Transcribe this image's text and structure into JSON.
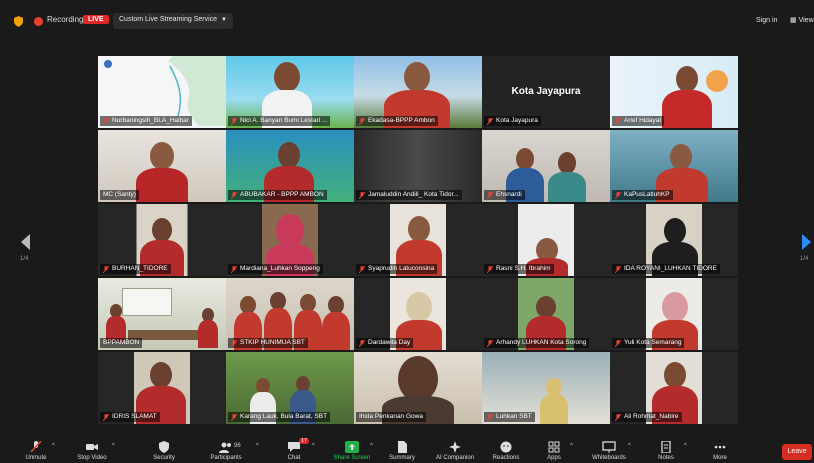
{
  "topbar": {
    "recording": "Recording",
    "live": "LIVE",
    "stream_menu": "Custom Live Streaming Service",
    "sign_in": "Sign in",
    "view": "View"
  },
  "pager": {
    "left": "1/4",
    "right": "1/4"
  },
  "participants": [
    {
      "name": "Nurbaningsih_BLA_Halbar",
      "muted": true
    },
    {
      "name": "Nici A. Banyan Bumi Lestari ...",
      "muted": true
    },
    {
      "name": "Ekadasa-BPPP Ambon",
      "muted": true
    },
    {
      "name": "Kota Jayapura",
      "muted": true,
      "center_label": "Kota Jayapura"
    },
    {
      "name": "Arief Hidayat",
      "muted": true
    },
    {
      "name": "MC (Santy)",
      "muted": false
    },
    {
      "name": "ABUBAKAR - BPPP AMBON",
      "muted": true
    },
    {
      "name": "Jamaluddin Andili_ Kota Tidor...",
      "muted": true
    },
    {
      "name": "Ehsnardi",
      "muted": true
    },
    {
      "name": "KaPusLatluhKP",
      "muted": true
    },
    {
      "name": "BURHAN_TIDORE",
      "muted": true
    },
    {
      "name": "Mardiana_Luhkan Soppeng",
      "muted": true
    },
    {
      "name": "Syaprudin Latuconsina",
      "muted": true
    },
    {
      "name": "Rasni S.H. Ibrahim",
      "muted": true
    },
    {
      "name": "IDA ROYANI_LUHKAN TIDORE",
      "muted": true
    },
    {
      "name": "BPPAMBON",
      "muted": false
    },
    {
      "name": "STKIP HUNIMUA SBT",
      "muted": true
    },
    {
      "name": "Dardawila Day",
      "muted": true
    },
    {
      "name": "Arhandy LUHKAN Kota Sorong",
      "muted": true
    },
    {
      "name": "Yuli Kota Semarang",
      "muted": true
    },
    {
      "name": "IDRIS SLAMAT",
      "muted": true
    },
    {
      "name": "Karang Lauk, Bula Barat, SBT",
      "muted": true
    },
    {
      "name": "Ihida Penkanan Gowa",
      "muted": false
    },
    {
      "name": "Luhkan SBT",
      "muted": true
    },
    {
      "name": "Ali Rohmat_Nabire",
      "muted": true
    }
  ],
  "toolbar": {
    "unmute": "Unmute",
    "stop_video": "Stop Video",
    "security": "Security",
    "participants": "Participants",
    "participants_count": "96",
    "chat": "Chat",
    "chat_badge": "17",
    "share_screen": "Share Screen",
    "summary": "Summary",
    "ai_companion": "AI Companion",
    "reactions": "Reactions",
    "apps": "Apps",
    "whiteboards": "Whiteboards",
    "notes": "Notes",
    "more": "More",
    "leave": "Leave"
  },
  "colors": {
    "accent_green": "#a8d34a",
    "live_red": "#e02828",
    "leave_red": "#d42d22",
    "share_green": "#1fae48"
  }
}
